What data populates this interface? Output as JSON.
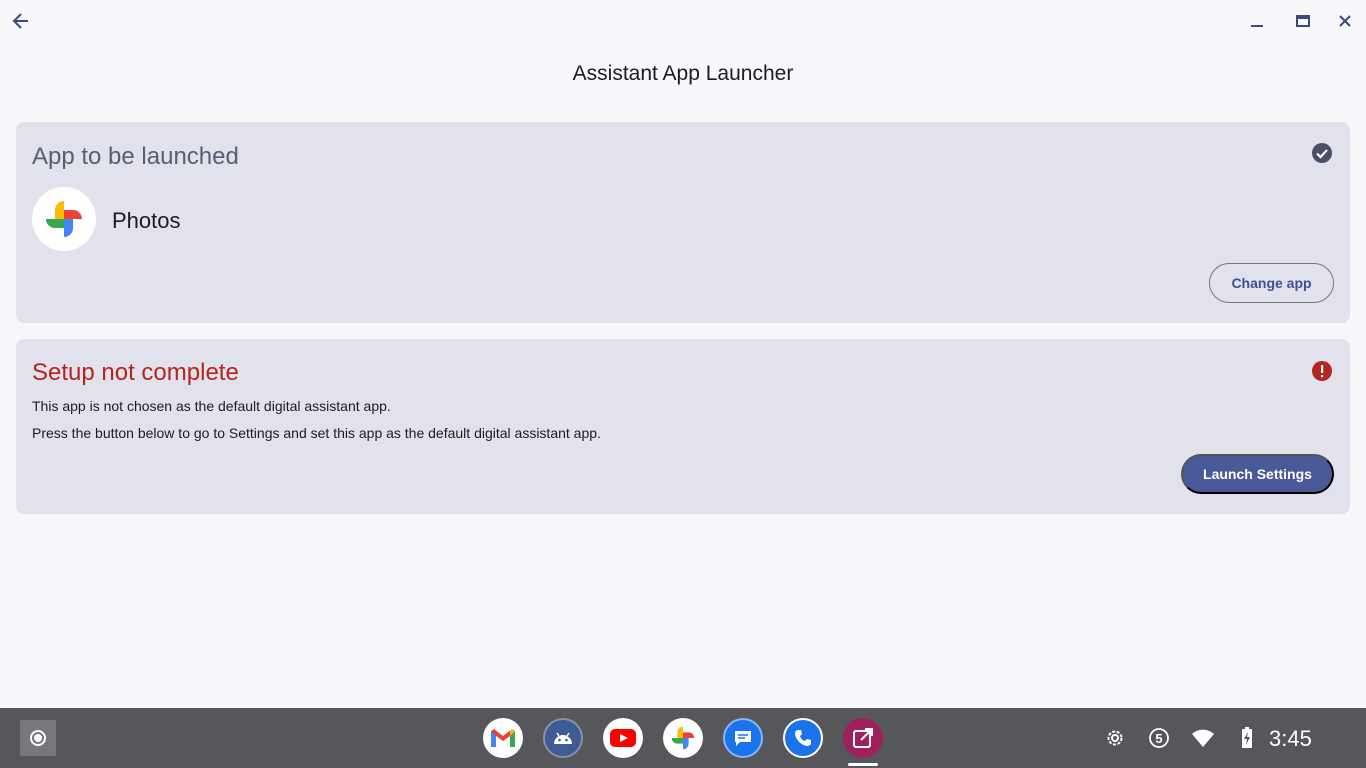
{
  "window": {
    "title": "Assistant App Launcher",
    "controls": [
      "back-icon",
      "minimize-icon",
      "maximize-icon",
      "close-icon"
    ]
  },
  "app_card": {
    "title": "App to be launched",
    "status_icon": "check-circle-icon",
    "app_name": "Photos",
    "app_icon": "google-photos-icon",
    "change_button": "Change app"
  },
  "setup_card": {
    "title": "Setup not complete",
    "status_icon": "error-icon",
    "line1": "This app is not chosen as the default digital assistant app.",
    "line2": "Press the button below to go to Settings and set this app as the default digital assistant app.",
    "launch_button": "Launch Settings"
  },
  "colors": {
    "background": "#f7f7fc",
    "card": "#e2e2ec",
    "error": "#b3261e",
    "primary_button": "#4a5a98",
    "shelf": "#56575b"
  },
  "shelf": {
    "apps": [
      "gmail-icon",
      "android-studio-icon",
      "youtube-icon",
      "photos-icon",
      "messages-icon",
      "phone-icon",
      "assistant-launcher-icon"
    ],
    "tray": {
      "settings_icon": "gear-icon",
      "notification_count": "5",
      "wifi_icon": "wifi-icon",
      "battery_icon": "battery-charging-icon",
      "time": "3:45"
    }
  }
}
